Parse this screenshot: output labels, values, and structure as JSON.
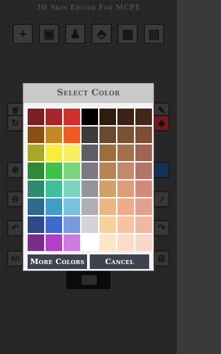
{
  "app": {
    "title": "3D Skin Editor For MCPE",
    "toolbar": [
      {
        "icon": "plus-icon",
        "glyph": "+"
      },
      {
        "icon": "image-icon",
        "glyph": "▣"
      },
      {
        "icon": "person-icon",
        "glyph": "♟"
      },
      {
        "icon": "shirt-icon",
        "glyph": "⬘"
      },
      {
        "icon": "grid-icon",
        "glyph": "▦"
      },
      {
        "icon": "clipboard-icon",
        "glyph": "▤"
      }
    ],
    "left_tools": [
      {
        "icon": "trash-icon",
        "glyph": "🗑"
      },
      {
        "icon": "rotate-icon",
        "glyph": "↻"
      },
      {
        "icon": "zoom-in-icon",
        "glyph": "⊕"
      },
      {
        "icon": "zoom-out-icon",
        "glyph": "⊖"
      },
      {
        "icon": "undo-icon",
        "glyph": "↶"
      },
      {
        "icon": "ad-icon",
        "glyph": "AD"
      }
    ],
    "right_tools": [
      {
        "icon": "pencil-icon",
        "glyph": "✎"
      },
      {
        "icon": "bucket-icon",
        "glyph": "◆"
      },
      {
        "icon": "color-preview-icon",
        "glyph": ""
      },
      {
        "icon": "eyedropper-icon",
        "glyph": "⁄"
      },
      {
        "icon": "redo-icon",
        "glyph": "↷"
      },
      {
        "icon": "gamepad-icon",
        "glyph": "⊞"
      }
    ]
  },
  "dialog": {
    "title": "Select Color",
    "more_colors_label": "More Colors",
    "cancel_label": "Cancel"
  },
  "palette": [
    [
      "#7a1f22",
      "#a8262b",
      "#d2302f",
      "#000000",
      "#2e1e10",
      "#3a2214",
      "#43281a"
    ],
    [
      "#8a5212",
      "#c48a22",
      "#f05a22",
      "#3c3c3c",
      "#6a4a2c",
      "#7a5234",
      "#7e4e38"
    ],
    [
      "#a8a826",
      "#f8ec3c",
      "#f8f060",
      "#5e5e66",
      "#9a6e3e",
      "#a2704e",
      "#9e6454"
    ],
    [
      "#2e8a36",
      "#3ec24a",
      "#7ad47a",
      "#7a7a80",
      "#b78454",
      "#c4886a",
      "#b4746c"
    ],
    [
      "#2e8a6e",
      "#3ebf9e",
      "#7ad4be",
      "#94949a",
      "#d2a06a",
      "#dc9e7a",
      "#d48a7a"
    ],
    [
      "#2e6a8a",
      "#3e9ec6",
      "#7ac0e0",
      "#b0b0b4",
      "#eab682",
      "#eeac8a",
      "#e4a08a"
    ],
    [
      "#2e4a8a",
      "#3e6ad0",
      "#7a9ae0",
      "#d4d4d6",
      "#f8d0a0",
      "#f6c4a4",
      "#f0b8a2"
    ],
    [
      "#7a2e8a",
      "#b43ec6",
      "#d07ae0",
      "#ffffff",
      "#fde6c6",
      "#fbdcc8",
      "#f8d6c8"
    ]
  ]
}
